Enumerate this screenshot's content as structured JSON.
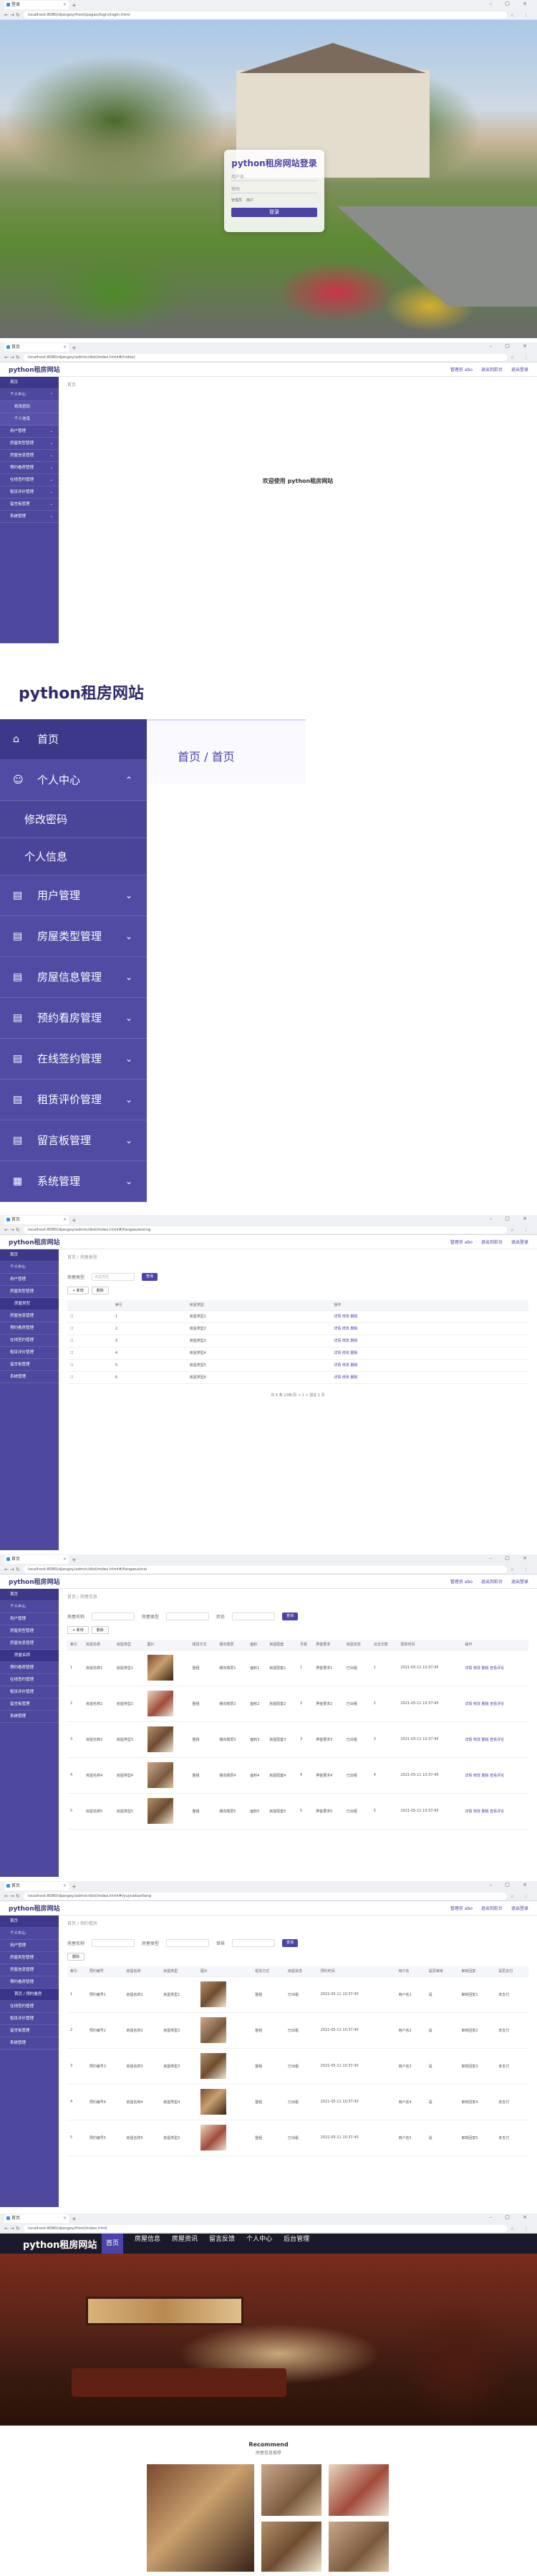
{
  "browser": {
    "tab_title": "登录",
    "tab_title_admin": "首页",
    "url_login": "localhost:8080/djangoy/front/pages/login/login.html",
    "url_home": "localhost:8080/djangoy/admin/dist/index.html#/index/",
    "url_fangwu": "localhost:8080/djangoy/admin/dist/index.html#/fangwuleixing",
    "url_xinxi": "localhost:8080/djangoy/admin/dist/index.html#/fangwuxinxi",
    "url_yuyue": "localhost:8080/djangoy/admin/dist/index.html#/yuyuekanfang",
    "url_front": "localhost:8080/djangoy/front/index.html"
  },
  "login": {
    "title": "python租房网站登录",
    "username_placeholder": "用户名",
    "password_placeholder": "密码",
    "roles": [
      "管理员",
      "用户"
    ],
    "button": "登录"
  },
  "admin": {
    "brand": "python租房网站",
    "top_links": [
      "管理员 abo",
      "退出到前台",
      "退出登录"
    ],
    "welcome": "欢迎使用 python租房网站",
    "crumb_home": "首页",
    "sidebar": [
      {
        "label": "首页",
        "type": "home"
      },
      {
        "label": "个人中心",
        "type": "group"
      },
      {
        "label": "修改密码",
        "type": "sub"
      },
      {
        "label": "个人信息",
        "type": "sub"
      },
      {
        "label": "用户管理",
        "type": "group"
      },
      {
        "label": "房屋类型管理",
        "type": "group"
      },
      {
        "label": "房屋信息管理",
        "type": "group"
      },
      {
        "label": "预约看房管理",
        "type": "group"
      },
      {
        "label": "在线签约管理",
        "type": "group"
      },
      {
        "label": "租赁评价管理",
        "type": "group"
      },
      {
        "label": "留言板管理",
        "type": "group"
      },
      {
        "label": "系统管理",
        "type": "group"
      }
    ]
  },
  "zoom": {
    "title": "python租房网站",
    "crumb": "首页  /  首页"
  },
  "types_page": {
    "crumb": "首页  /  房屋类型",
    "filter_label": "房屋类型",
    "filter_placeholder": "房屋类型",
    "search": "查询",
    "add": "+ 新增",
    "del": "删除",
    "columns": [
      "",
      "索引",
      "房屋类型",
      "操作"
    ],
    "rows": [
      {
        "idx": "1",
        "name": "房屋类型1"
      },
      {
        "idx": "2",
        "name": "房屋类型2"
      },
      {
        "idx": "3",
        "name": "房屋类型3"
      },
      {
        "idx": "4",
        "name": "房屋类型4"
      },
      {
        "idx": "5",
        "name": "房屋类型5"
      },
      {
        "idx": "6",
        "name": "房屋类型6"
      }
    ],
    "actions": "详情  修改  删除",
    "pager": "共 6 条   10条/页   <  1  >   前往  1  页"
  },
  "info_page": {
    "crumb": "首页  /  房屋信息",
    "filters": [
      "房屋名称",
      "房屋类型",
      "状态"
    ],
    "search": "查询",
    "add": "+ 新增",
    "del": "删除",
    "columns": [
      "索引",
      "房屋名称",
      "房屋类型",
      "图片",
      "租赁方式",
      "朝向楼层",
      "面积",
      "房屋配套",
      "月租",
      "押金要求",
      "房屋状态",
      "点击次数",
      "更新时间",
      "操作"
    ],
    "rows": [
      {
        "idx": "1",
        "name": "房屋名称1",
        "type": "房屋类型1",
        "mode": "整租",
        "floor": "朝向楼层1",
        "area": "面积1",
        "fit": "房屋配套1",
        "rent": "1",
        "deposit": "押金要求1",
        "status": "已出租",
        "clicks": "1",
        "time": "2021-05-11 10:37:45"
      },
      {
        "idx": "2",
        "name": "房屋名称2",
        "type": "房屋类型2",
        "mode": "整租",
        "floor": "朝向楼层2",
        "area": "面积2",
        "fit": "房屋配套2",
        "rent": "2",
        "deposit": "押金要求2",
        "status": "已出租",
        "clicks": "2",
        "time": "2021-05-11 10:37:45"
      },
      {
        "idx": "3",
        "name": "房屋名称3",
        "type": "房屋类型3",
        "mode": "整租",
        "floor": "朝向楼层3",
        "area": "面积3",
        "fit": "房屋配套3",
        "rent": "3",
        "deposit": "押金要求3",
        "status": "已出租",
        "clicks": "3",
        "time": "2021-05-11 10:37:45"
      },
      {
        "idx": "4",
        "name": "房屋名称4",
        "type": "房屋类型4",
        "mode": "整租",
        "floor": "朝向楼层4",
        "area": "面积4",
        "fit": "房屋配套4",
        "rent": "4",
        "deposit": "押金要求4",
        "status": "已出租",
        "clicks": "4",
        "time": "2021-05-11 10:37:45"
      },
      {
        "idx": "5",
        "name": "房屋名称5",
        "type": "房屋类型5",
        "mode": "整租",
        "floor": "朝向楼层5",
        "area": "面积5",
        "fit": "房屋配套5",
        "rent": "5",
        "deposit": "押金要求5",
        "status": "已出租",
        "clicks": "5",
        "time": "2021-05-11 10:37:45"
      }
    ],
    "actions": "详情 修改 删除 查看评论"
  },
  "yuyue_page": {
    "crumb": "首页  /  预约看房",
    "filters": [
      "房屋名称",
      "房屋类型",
      "审核"
    ],
    "search": "查询",
    "del": "删除",
    "columns": [
      "索引",
      "预约编号",
      "房屋名称",
      "房屋类型",
      "图片",
      "租赁方式",
      "朝向楼层",
      "面积",
      "房屋配套",
      "月租",
      "押金要求",
      "房屋状态",
      "预约时间",
      "用户名",
      "姓名",
      "联系方式",
      "是否审核",
      "审核回复",
      "是否支付",
      "操作"
    ],
    "rows": [
      {
        "idx": "1",
        "no": "预约编号1",
        "name": "房屋名称1",
        "type": "房屋类型1",
        "mode": "整租",
        "status": "已出租",
        "time": "2021-05-11 10:37:45",
        "user": "用户名1",
        "audit": "是",
        "reply": "审核回复1",
        "pay": "未支付"
      },
      {
        "idx": "2",
        "no": "预约编号2",
        "name": "房屋名称2",
        "type": "房屋类型2",
        "mode": "整租",
        "status": "已出租",
        "time": "2021-05-11 10:37:45",
        "user": "用户名2",
        "audit": "是",
        "reply": "审核回复2",
        "pay": "未支付"
      },
      {
        "idx": "3",
        "no": "预约编号3",
        "name": "房屋名称3",
        "type": "房屋类型3",
        "mode": "整租",
        "status": "已出租",
        "time": "2021-05-11 10:37:45",
        "user": "用户名3",
        "audit": "是",
        "reply": "审核回复3",
        "pay": "未支付"
      },
      {
        "idx": "4",
        "no": "预约编号4",
        "name": "房屋名称4",
        "type": "房屋类型4",
        "mode": "整租",
        "status": "已出租",
        "time": "2021-05-11 10:37:45",
        "user": "用户名4",
        "audit": "是",
        "reply": "审核回复4",
        "pay": "未支付"
      },
      {
        "idx": "5",
        "no": "预约编号5",
        "name": "房屋名称5",
        "type": "房屋类型5",
        "mode": "整租",
        "status": "已出租",
        "time": "2021-05-11 10:37:45",
        "user": "用户名5",
        "audit": "是",
        "reply": "审核回复5",
        "pay": "未支付"
      }
    ]
  },
  "front": {
    "logo": "python租房网站",
    "nav": [
      "首页",
      "房屋信息",
      "房屋资讯",
      "留言反馈",
      "个人中心",
      "后台管理"
    ],
    "section_title": "Recommend",
    "section_sub": "房屋信息推荐"
  }
}
